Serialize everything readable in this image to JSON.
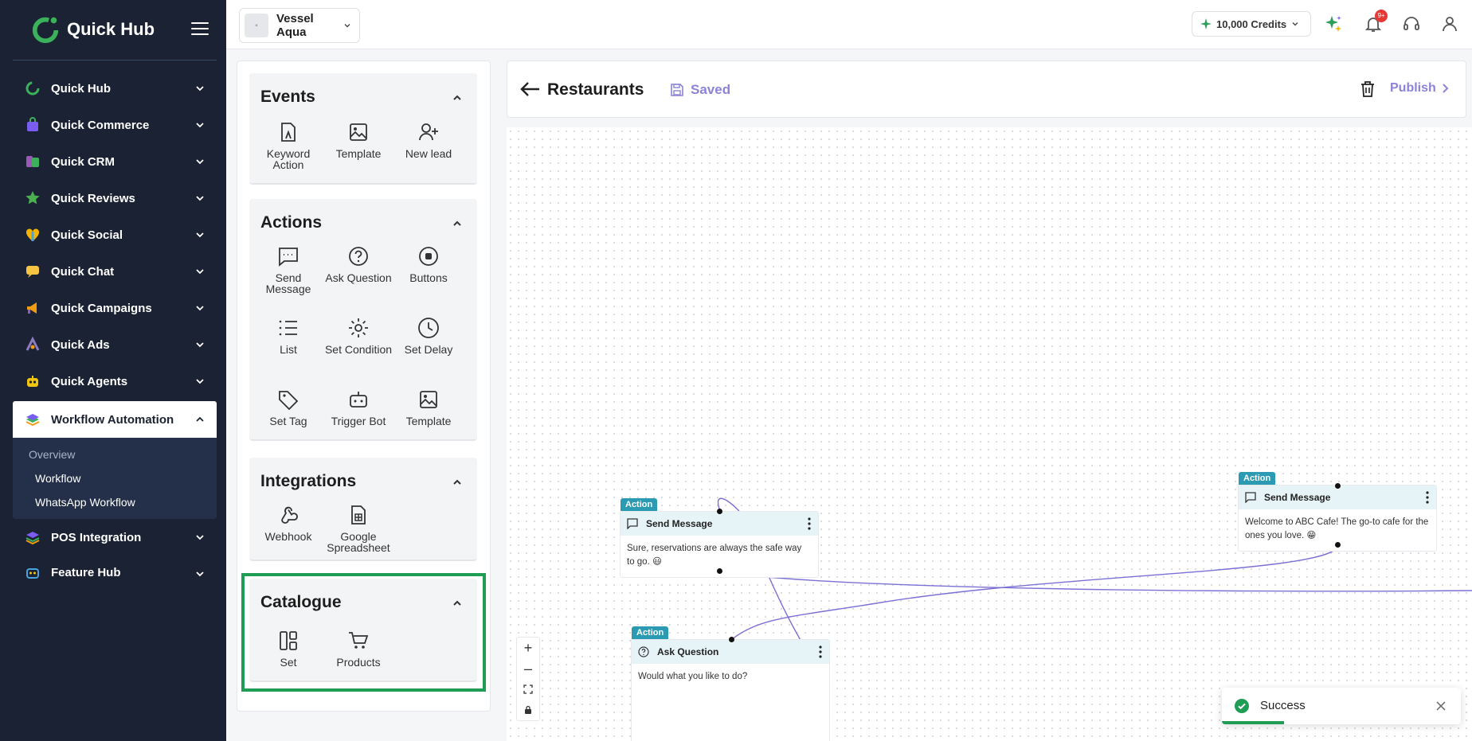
{
  "brand": {
    "name": "Quick Hub"
  },
  "sidebar": {
    "items": [
      {
        "label": "Quick Hub",
        "icon": "quick-hub-icon",
        "color": "#3ab15a"
      },
      {
        "label": "Quick Commerce",
        "icon": "commerce-bag-icon",
        "color": "#7a5cf0"
      },
      {
        "label": "Quick CRM",
        "icon": "crm-icon",
        "color": "#9b59b6"
      },
      {
        "label": "Quick Reviews",
        "icon": "star-icon",
        "color": "#4caf50"
      },
      {
        "label": "Quick Social",
        "icon": "heart-shield-icon",
        "color": "#f4b400"
      },
      {
        "label": "Quick Chat",
        "icon": "chat-bubble-icon",
        "color": "#f6c343"
      },
      {
        "label": "Quick Campaigns",
        "icon": "megaphone-icon",
        "color": "#f39c12"
      },
      {
        "label": "Quick Ads",
        "icon": "ads-icon",
        "color": "#8e7cc3"
      },
      {
        "label": "Quick Agents",
        "icon": "robot-icon",
        "color": "#f1c40f"
      }
    ],
    "active": {
      "label": "Workflow Automation",
      "icon": "workflow-layers-icon",
      "subitems": [
        {
          "label": "Overview"
        },
        {
          "label": "Workflow"
        },
        {
          "label": "WhatsApp Workflow"
        }
      ]
    },
    "after": [
      {
        "label": "POS Integration",
        "icon": "pos-layers-icon"
      },
      {
        "label": "Feature Hub",
        "icon": "feature-robot-icon"
      }
    ]
  },
  "topbar": {
    "workspace": "Vessel Aqua",
    "credits": "10,000 Credits",
    "notification_count": "9+"
  },
  "panel": {
    "events": {
      "title": "Events",
      "tools": [
        {
          "label": "Keyword Action"
        },
        {
          "label": "Template"
        },
        {
          "label": "New lead"
        }
      ]
    },
    "actions": {
      "title": "Actions",
      "tools": [
        {
          "label": "Send Message"
        },
        {
          "label": "Ask Question"
        },
        {
          "label": "Buttons"
        },
        {
          "label": "List"
        },
        {
          "label": "Set Condition"
        },
        {
          "label": "Set Delay"
        },
        {
          "label": "Set Tag"
        },
        {
          "label": "Trigger Bot"
        },
        {
          "label": "Template"
        }
      ]
    },
    "integrations": {
      "title": "Integrations",
      "tools": [
        {
          "label": "Webhook"
        },
        {
          "label": "Google Spreadsheet"
        }
      ]
    },
    "catalogue": {
      "title": "Catalogue",
      "tools": [
        {
          "label": "Set"
        },
        {
          "label": "Products"
        }
      ]
    }
  },
  "canvas_header": {
    "title": "Restaurants",
    "status": "Saved",
    "publish": "Publish"
  },
  "nodes": [
    {
      "tag": "Action",
      "title": "Send Message",
      "body": "Sure, reservations are always the safe way to go. 😃"
    },
    {
      "tag": "Action",
      "title": "Send Message",
      "body": "Welcome to ABC Cafe! The go-to cafe for the ones you love. 😁"
    },
    {
      "tag": "Action",
      "title": "Ask Question",
      "body": "Would what you like to do?"
    }
  ],
  "toast": {
    "message": "Success",
    "progress": 0.26
  },
  "colors": {
    "accent": "#8c83d6",
    "sidebar_bg": "#1a2233",
    "node_tag": "#2b9bb4",
    "success": "#1f9d55"
  }
}
